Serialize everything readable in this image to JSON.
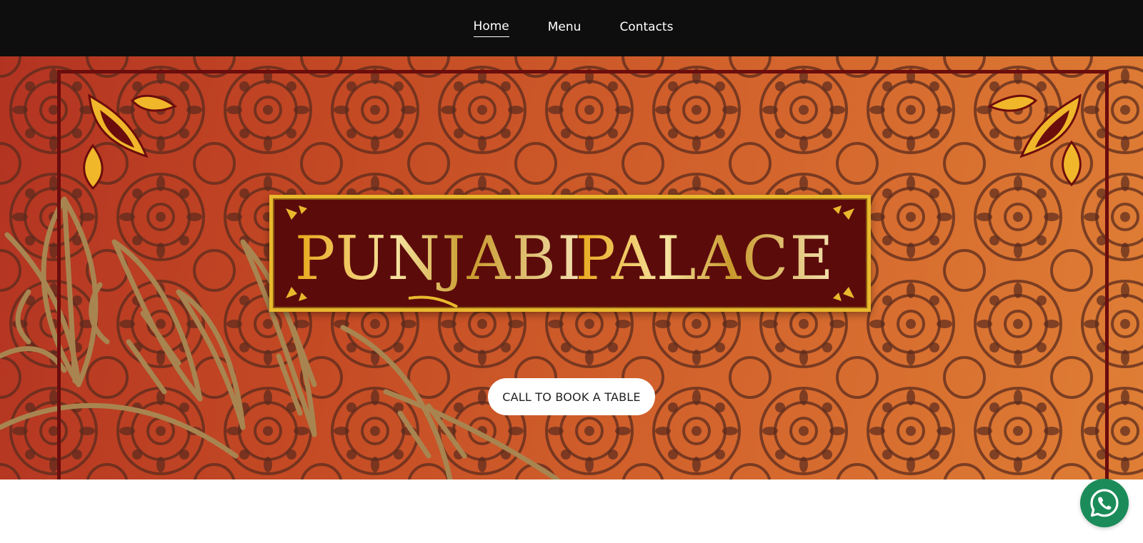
{
  "nav": {
    "items": [
      {
        "label": "Home",
        "active": true
      },
      {
        "label": "Menu",
        "active": false
      },
      {
        "label": "Contacts",
        "active": false
      }
    ]
  },
  "hero": {
    "logo_text_left": "PUNJABI",
    "logo_text_right": "PALACE",
    "cta_label": "CALL TO BOOK A TABLE"
  },
  "floating": {
    "icon": "whatsapp-icon"
  },
  "colors": {
    "nav_bg": "#0e0e0e",
    "banner_bg": "#5c0b0b",
    "gold": "#e9b92d",
    "hero_red": "#b33322",
    "hero_orange": "#df7e35",
    "whatsapp_green": "#1b8c59"
  }
}
